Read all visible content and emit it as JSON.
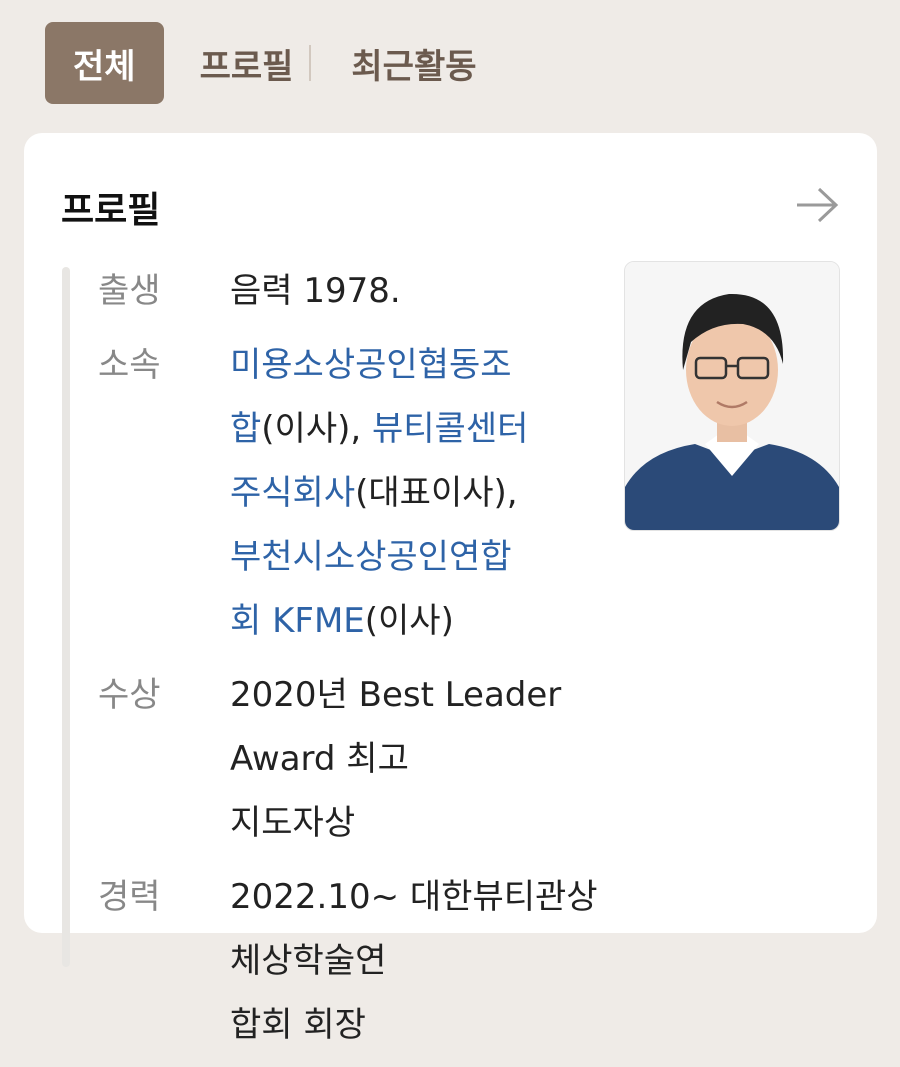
{
  "tabs": {
    "all": "전체",
    "profile": "프로필",
    "recent": "최근활동"
  },
  "card": {
    "title": "프로필"
  },
  "rows": {
    "birth": {
      "label": "출생",
      "value": "음력 1978."
    },
    "affiliation": {
      "label": "소속",
      "link1": "미용소상공인협동조",
      "link1b": "합",
      "text1": "(이사), ",
      "link2": "뷰티콜센터",
      "link2b": "주식회사",
      "text2": "(대표이사),",
      "link3": "부천시소상공인연합",
      "link3b": "회 KFME",
      "text3": "(이사)"
    },
    "award": {
      "label": "수상",
      "line1": "2020년 Best Leader Award 최고",
      "line2": "지도자상"
    },
    "career": {
      "label": "경력",
      "line1": "2022.10~ 대한뷰티관상체상학술연",
      "line2": "합회 회장"
    }
  },
  "colors": {
    "accent": "#8b7767",
    "link": "#2e63a7",
    "sweater": "#2b4a78"
  },
  "icons": {
    "arrow": "arrow-right-icon"
  }
}
